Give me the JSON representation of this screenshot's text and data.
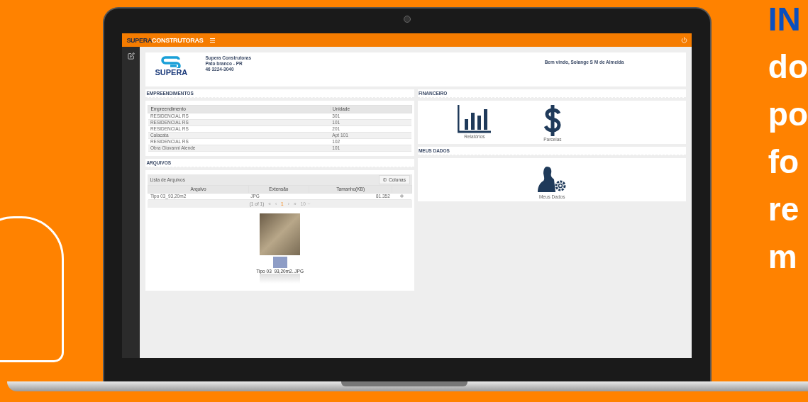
{
  "app": {
    "brand_bold": "SUPERA",
    "brand_rest": "CONSTRUTORAS"
  },
  "header": {
    "logo_text": "SUPERA",
    "company": [
      "Supera Construtoras",
      "Pato branco - PR",
      "46 3224-3040"
    ],
    "welcome": "Bem vindo, Solange S M de Almeida"
  },
  "empreendimentos": {
    "title": "EMPREENDIMENTOS",
    "columns": [
      "Empreendimento",
      "Unidade"
    ],
    "rows": [
      [
        "RESIDENCIAL RS",
        "301"
      ],
      [
        "RESIDENCIAL RS",
        "101"
      ],
      [
        "RESIDENCIAL RS",
        "201"
      ],
      [
        "Calacata",
        "Apt 101"
      ],
      [
        "RESIDENCIAL RS",
        "102"
      ],
      [
        "Obra Giovanni Alende",
        "101"
      ]
    ]
  },
  "arquivos": {
    "title": "ARQUIVOS",
    "list_title": "Lista de Arquivos",
    "columns_button": "Colunas",
    "columns": [
      "Arquivo",
      "Extensão",
      "Tamanho(KB)"
    ],
    "rows": [
      [
        "Tipo 03_93,20m2",
        "JPG",
        "81.352"
      ]
    ],
    "pager": {
      "info": "(1 of 1)",
      "first": "«",
      "prev": "‹",
      "page": "1",
      "next": "›",
      "last": "»",
      "page_size": "10"
    },
    "preview_caption": "Tipo 03_93,20m2..JPG"
  },
  "financeiro": {
    "title": "FINANCEIRO",
    "items": [
      {
        "kind": "chart",
        "label": "Relatórios"
      },
      {
        "kind": "dollar",
        "label": "Parcelas"
      }
    ]
  },
  "meus_dados": {
    "title": "MEUS DADOS",
    "items": [
      {
        "kind": "user-settings",
        "label": "Meus Dados"
      }
    ]
  },
  "promo": {
    "lines": [
      {
        "text": "IN",
        "kind": "accent"
      },
      {
        "text": "do",
        "kind": "plain"
      },
      {
        "text": "po",
        "kind": "plain"
      },
      {
        "text": "fo",
        "kind": "plain"
      },
      {
        "text": "re",
        "kind": "plain"
      },
      {
        "text": "m",
        "kind": "plain"
      }
    ]
  }
}
